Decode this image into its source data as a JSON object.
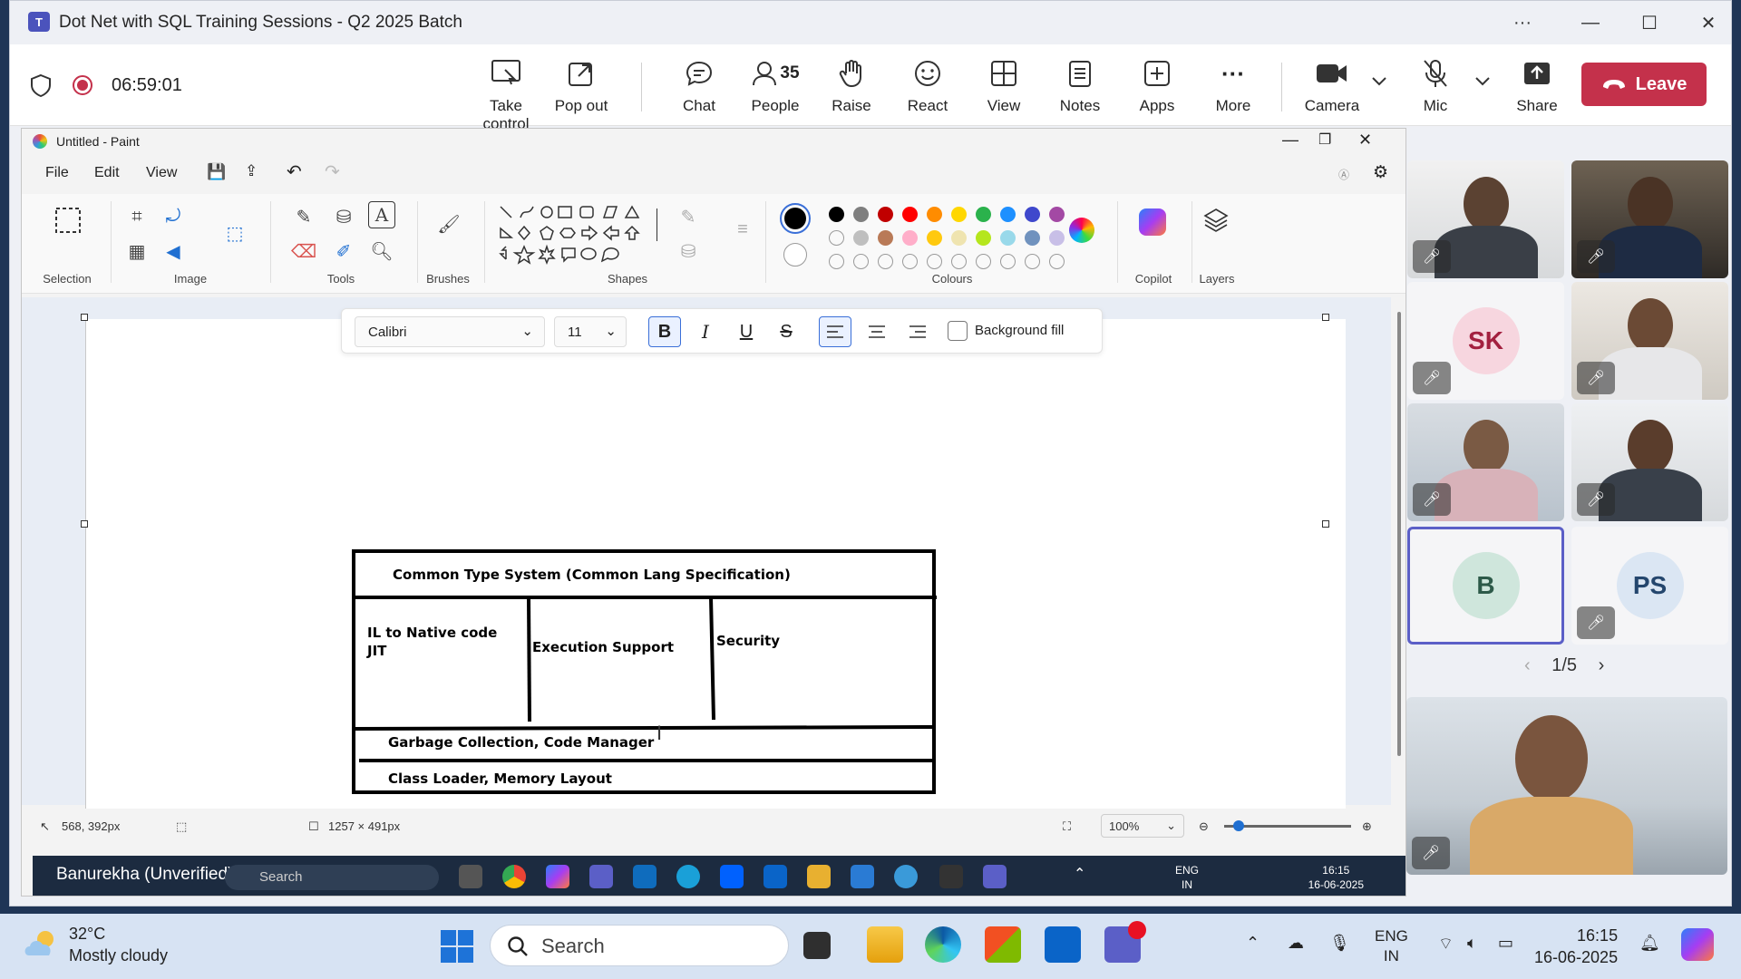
{
  "teams": {
    "window_title": "Dot Net with SQL Training Sessions - Q2 2025 Batch",
    "timer": "06:59:01",
    "toolbar": [
      {
        "label": "Take control",
        "icon": "take-control-icon"
      },
      {
        "label": "Pop out",
        "icon": "pop-out-icon"
      },
      {
        "label": "Chat",
        "icon": "chat-icon"
      },
      {
        "label": "People",
        "icon": "people-icon",
        "count": "35"
      },
      {
        "label": "Raise",
        "icon": "raise-hand-icon"
      },
      {
        "label": "React",
        "icon": "react-icon"
      },
      {
        "label": "View",
        "icon": "view-icon"
      },
      {
        "label": "Notes",
        "icon": "notes-icon"
      },
      {
        "label": "Apps",
        "icon": "apps-icon"
      },
      {
        "label": "More",
        "icon": "more-icon"
      },
      {
        "label": "Camera",
        "icon": "camera-icon"
      },
      {
        "label": "Mic",
        "icon": "mic-off-icon"
      },
      {
        "label": "Share",
        "icon": "share-icon"
      }
    ],
    "leave_label": "Leave",
    "leave_color": "#c4314b",
    "pager": "1/5",
    "participants": [
      {
        "initials": "",
        "muted": true
      },
      {
        "initials": "",
        "muted": true
      },
      {
        "initials": "SK",
        "muted": true,
        "color": "#f7d6df",
        "text_color": "#a3203f"
      },
      {
        "initials": "",
        "muted": true
      },
      {
        "initials": "",
        "muted": true
      },
      {
        "initials": "",
        "muted": true
      },
      {
        "initials": "B",
        "muted": false,
        "color": "#cfe6dc",
        "text_color": "#2d5a49",
        "active_border": "#5b5fc7"
      },
      {
        "initials": "PS",
        "muted": true,
        "color": "#dbe6f3",
        "text_color": "#24466d"
      }
    ]
  },
  "paint": {
    "title": "Untitled - Paint",
    "menu": [
      "File",
      "Edit",
      "View"
    ],
    "groups": [
      "Selection",
      "Image",
      "Tools",
      "Brushes",
      "Shapes",
      "Colours",
      "Copilot",
      "Layers"
    ],
    "colors_row1": [
      "#000000",
      "#7f7f7f",
      "#c00000",
      "#ff0000",
      "#ff8c00",
      "#ffd700",
      "#2bb24c",
      "#1e90ff",
      "#3f48cc",
      "#a349a4"
    ],
    "colors_row2": [
      "",
      "#bfbfbf",
      "#b97a57",
      "#ffaec9",
      "#ffc90e",
      "#efe4b0",
      "#b5e61d",
      "#99d9ea",
      "#7092be",
      "#c8bfe7"
    ],
    "text_toolbar": {
      "font": "Calibri",
      "size": "11",
      "background_fill_label": "Background fill"
    },
    "diagram": {
      "header": "Common Type System  (Common Lang Specification)",
      "col1_line1": "IL to Native code",
      "col1_line2": "JIT",
      "col2": "Execution Support",
      "col3": "Security",
      "row2": "Garbage Collection, Code Manager",
      "row3": "Class Loader, Memory Layout"
    },
    "status": {
      "cursor": "568, 392px",
      "canvas_size": "1257 × 491px",
      "zoom": "100%"
    }
  },
  "shared_taskbar": {
    "presenter": "Banurekha (Unverified)",
    "search": "Search",
    "lang1": "ENG",
    "lang2": "IN",
    "time": "16:15",
    "date": "16-06-2025"
  },
  "taskbar": {
    "temperature": "32°C",
    "weather": "Mostly cloudy",
    "search_placeholder": "Search",
    "lang1": "ENG",
    "lang2": "IN",
    "time": "16:15",
    "date": "16-06-2025"
  }
}
